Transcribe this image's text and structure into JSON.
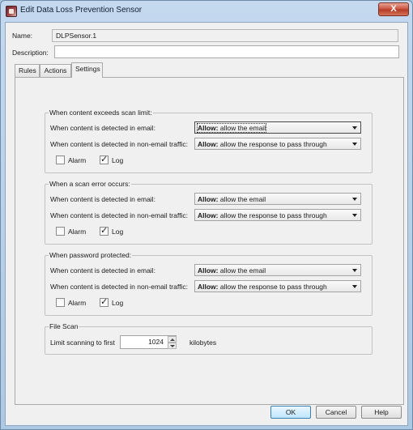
{
  "window": {
    "title": "Edit Data Loss Prevention Sensor",
    "close_label": "X"
  },
  "form": {
    "name_label": "Name:",
    "name_value": "DLPSensor.1",
    "description_label": "Description:",
    "description_value": ""
  },
  "tabs": [
    {
      "label": "Rules",
      "active": false
    },
    {
      "label": "Actions",
      "active": false
    },
    {
      "label": "Settings",
      "active": true
    }
  ],
  "settings": {
    "email_label": "When content is detected in email:",
    "nonemail_label": "When content is detected in non-email traffic:",
    "alarm_label": "Alarm",
    "log_label": "Log",
    "groups": [
      {
        "legend": "When content exceeds scan limit:",
        "email": {
          "bold": "Allow:",
          "text": " allow the email"
        },
        "nonemail": {
          "bold": "Allow:",
          "text": " allow the response to pass through"
        },
        "alarm": false,
        "log": true
      },
      {
        "legend": "When a scan error occurs:",
        "email": {
          "bold": "Allow:",
          "text": " allow the email"
        },
        "nonemail": {
          "bold": "Allow:",
          "text": " allow the response to pass through"
        },
        "alarm": false,
        "log": true
      },
      {
        "legend": "When password protected:",
        "email": {
          "bold": "Allow:",
          "text": " allow the email"
        },
        "nonemail": {
          "bold": "Allow:",
          "text": " allow the response to pass through"
        },
        "alarm": false,
        "log": true
      }
    ],
    "file_scan": {
      "legend": "File Scan",
      "limit_label": "Limit scanning to first",
      "limit_value": "1024",
      "unit": "kilobytes"
    }
  },
  "buttons": {
    "ok": "OK",
    "cancel": "Cancel",
    "help": "Help"
  },
  "icons": {
    "app": "dlp-sensor-icon",
    "checkbox_checked": "✓",
    "dropdown": "chevron-down-icon"
  },
  "colors": {
    "titlebar": "#c4d9ee",
    "close_button": "#c9523f",
    "default_button_border": "#3c7fb1"
  }
}
